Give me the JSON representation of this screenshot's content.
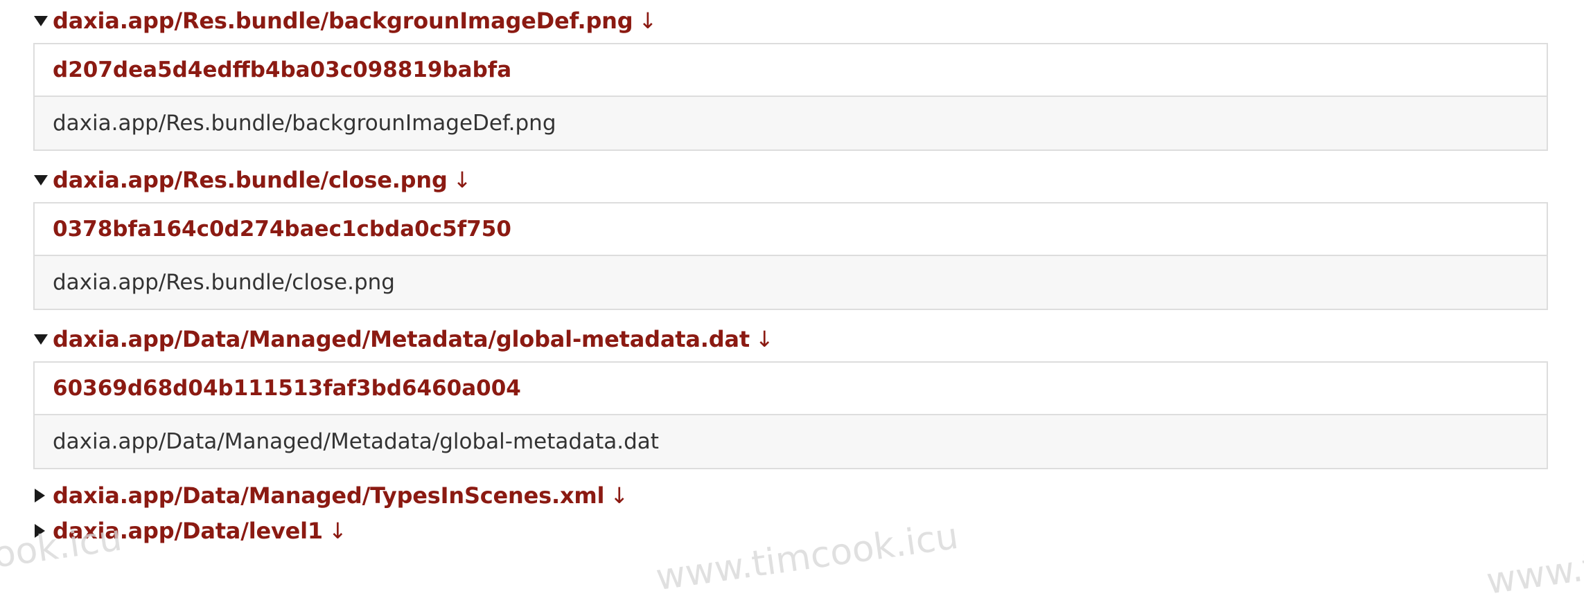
{
  "entries": [
    {
      "path": "daxia.app/Res.bundle/backgrounImageDef.png",
      "arrow": "↓",
      "hash": "d207dea5d4edffb4ba03c098819babfa",
      "file": "daxia.app/Res.bundle/backgrounImageDef.png"
    },
    {
      "path": "daxia.app/Res.bundle/close.png",
      "arrow": "↓",
      "hash": "0378bfa164c0d274baec1cbda0c5f750",
      "file": "daxia.app/Res.bundle/close.png"
    },
    {
      "path": "daxia.app/Data/Managed/Metadata/global-metadata.dat",
      "arrow": "↓",
      "hash": "60369d68d04b111513faf3bd6460a004",
      "file": "daxia.app/Data/Managed/Metadata/global-metadata.dat"
    },
    {
      "path": "daxia.app/Data/Managed/TypesInScenes.xml",
      "arrow": "↓"
    },
    {
      "path": "daxia.app/Data/level1",
      "arrow": "↓"
    }
  ],
  "watermarks": [
    "ook.icu",
    "www.timcook.icu",
    "www.t"
  ],
  "colors": {
    "link": "#8b1a12",
    "border": "#dddddd",
    "row_alt": "#f7f7f7",
    "text": "#333333"
  }
}
